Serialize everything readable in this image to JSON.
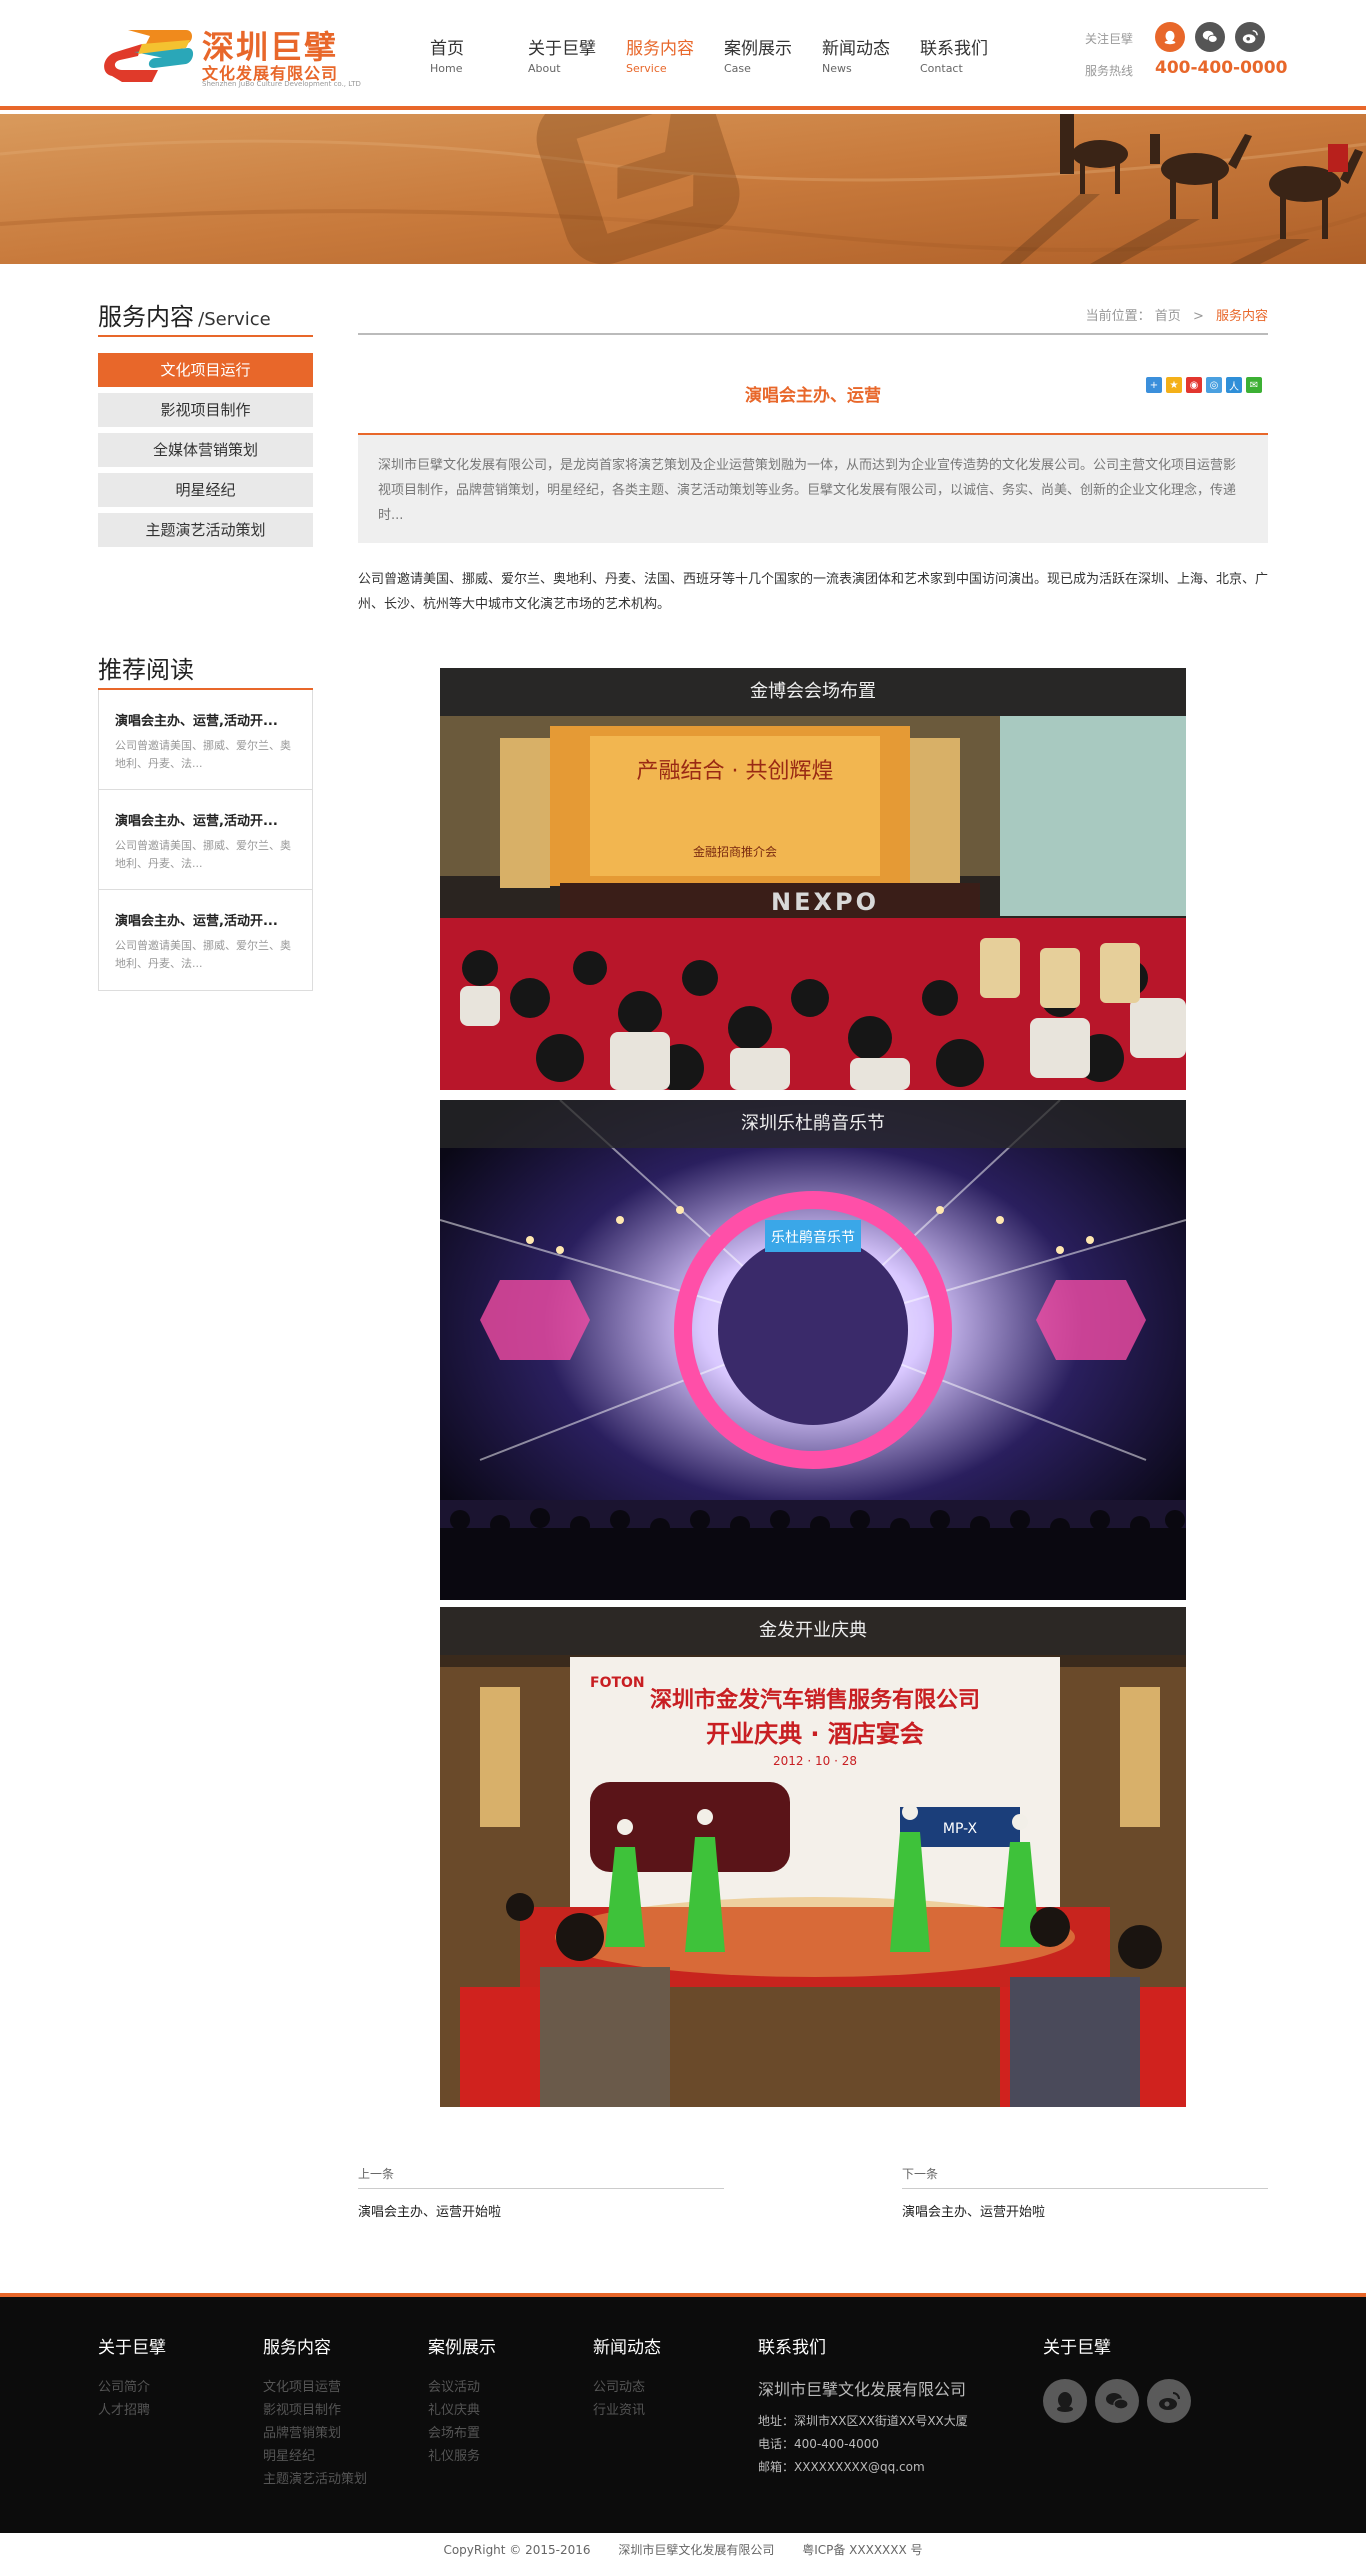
{
  "header": {
    "logo_cn": "深圳巨擘",
    "logo_sub": "文化发展有限公司",
    "logo_en": "Shenzhen JuBo Culture Development co., LTD",
    "nav": [
      {
        "cn": "首页",
        "en": "Home"
      },
      {
        "cn": "关于巨擘",
        "en": "About"
      },
      {
        "cn": "服务内容",
        "en": "Service"
      },
      {
        "cn": "案例展示",
        "en": "Case"
      },
      {
        "cn": "新闻动态",
        "en": "News"
      },
      {
        "cn": "联系我们",
        "en": "Contact"
      }
    ],
    "active_nav": 2,
    "follow_label": "关注巨擘",
    "hotline_label": "服务热线",
    "hotline": "400-400-0000"
  },
  "sidebar": {
    "title_cn": "服务内容",
    "title_en": "/Service",
    "items": [
      "文化项目运行",
      "影视项目制作",
      "全媒体营销策划",
      "明星经纪",
      "主题演艺活动策划"
    ],
    "active_item": 0
  },
  "recommend": {
    "title": "推荐阅读",
    "items": [
      {
        "title": "演唱会主办、运营,活动开...",
        "desc": "公司曾邀请美国、挪威、爱尔兰、奥地利、丹麦、法..."
      },
      {
        "title": "演唱会主办、运营,活动开...",
        "desc": "公司曾邀请美国、挪威、爱尔兰、奥地利、丹麦、法..."
      },
      {
        "title": "演唱会主办、运营,活动开...",
        "desc": "公司曾邀请美国、挪威、爱尔兰、奥地利、丹麦、法..."
      }
    ]
  },
  "breadcrumb": {
    "prefix": "当前位置：",
    "home": "首页",
    "sep": ">",
    "current": "服务内容"
  },
  "article": {
    "title": "演唱会主办、运营",
    "summary": "深圳市巨擘文化发展有限公司，是龙岗首家将演艺策划及企业运营策划融为一体，从而达到为企业宣传造势的文化发展公司。公司主营文化项目运营影视项目制作，品牌营销策划，明星经纪，各类主题、演艺活动策划等业务。巨擘文化发展有限公司，以诚信、务实、尚美、创新的企业文化理念，传递时...",
    "intro": "公司曾邀请美国、挪威、爱尔兰、奥地利、丹麦、法国、西班牙等十几个国家的一流表演团体和艺术家到中国访问演出。现已成为活跃在深圳、上海、北京、广州、长沙、杭州等大中城市文化演艺市场的艺术机构。",
    "photos": [
      {
        "caption": "金博会会场布置",
        "banner_text": "产融结合 · 共创辉煌",
        "sub_text": "金融招商推介会",
        "floor_text": "NEXPO"
      },
      {
        "caption": "深圳乐杜鹃音乐节",
        "screen_text": "乐杜鹃音乐节"
      },
      {
        "caption": "金发开业庆典",
        "brand_text": "FOTON",
        "banner_line1": "深圳市金发汽车销售服务有限公司",
        "banner_line2": "开业庆典 · 酒店宴会",
        "banner_date": "2012 · 10 · 28",
        "badge_text": "MP-X"
      }
    ],
    "prev_label": "上一条",
    "prev_title": "演唱会主办、运营开始啦",
    "next_label": "下一条",
    "next_title": "演唱会主办、运营开始啦"
  },
  "footer": {
    "about": {
      "title": "关于巨擘",
      "links": [
        "公司简介",
        "人才招聘"
      ]
    },
    "service": {
      "title": "服务内容",
      "links": [
        "文化项目运营",
        "影视项目制作",
        "品牌营销策划",
        "明星经纪",
        "主题演艺活动策划"
      ]
    },
    "cases": {
      "title": "案例展示",
      "links": [
        "会议活动",
        "礼仪庆典",
        "会场布置",
        "礼仪服务"
      ]
    },
    "news": {
      "title": "新闻动态",
      "links": [
        "公司动态",
        "行业资讯"
      ]
    },
    "contact": {
      "title": "联系我们",
      "company": "深圳市巨擘文化发展有限公司",
      "address": "地址：深圳市XX区XX街道XX号XX大厦",
      "phone": "电话：400-400-4000",
      "email": "邮箱：XXXXXXXXX@qq.com"
    },
    "follow_title": "关于巨擘",
    "copyright": "CopyRight © 2015-2016",
    "company": "深圳市巨擘文化发展有限公司",
    "icp": "粤ICP备 XXXXXXX 号"
  },
  "colors": {
    "accent": "#e8672a",
    "dark": "#0c0c0c"
  }
}
